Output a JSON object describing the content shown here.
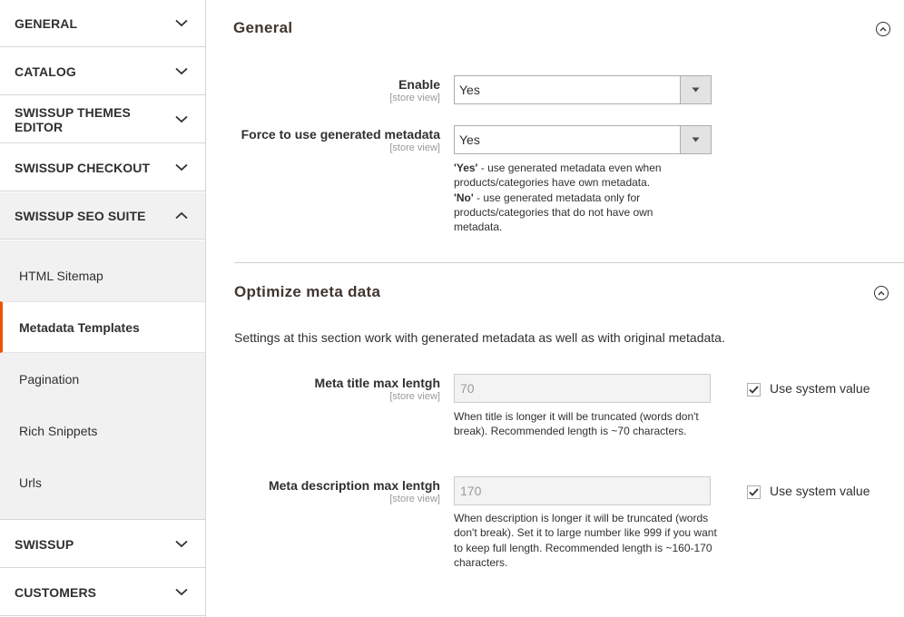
{
  "sidebar": {
    "sections": [
      {
        "label": "GENERAL",
        "expanded": false
      },
      {
        "label": "CATALOG",
        "expanded": false
      },
      {
        "label": "SWISSUP THEMES EDITOR",
        "expanded": false
      },
      {
        "label": "SWISSUP CHECKOUT",
        "expanded": false
      },
      {
        "label": "SWISSUP SEO SUITE",
        "expanded": true
      },
      {
        "label": "SWISSUP",
        "expanded": false
      },
      {
        "label": "CUSTOMERS",
        "expanded": false
      }
    ],
    "sub_items": [
      {
        "label": "HTML Sitemap",
        "active": false
      },
      {
        "label": "Metadata Templates",
        "active": true
      },
      {
        "label": "Pagination",
        "active": false
      },
      {
        "label": "Rich Snippets",
        "active": false
      },
      {
        "label": "Urls",
        "active": false
      }
    ],
    "accent_color": "#eb5202"
  },
  "general": {
    "title": "General",
    "enable": {
      "label": "Enable",
      "scope": "[store view]",
      "value": "Yes"
    },
    "force": {
      "label": "Force to use generated metadata",
      "scope": "[store view]",
      "value": "Yes",
      "note_yes_key": "'Yes'",
      "note_yes_text": " - use generated metadata even when products/categories have own metadata.",
      "note_no_key": "'No'",
      "note_no_text": " - use generated metadata only for products/categories that do not have own metadata."
    }
  },
  "optimize": {
    "title": "Optimize meta data",
    "intro": "Settings at this section work with generated metadata as well as with original metadata.",
    "title_len": {
      "label": "Meta title max lentgh",
      "scope": "[store view]",
      "value": "70",
      "use_system": "Use system value",
      "checked": true,
      "note": "When title is longer it will be truncated (words don't break). Recommended length is ~70 characters."
    },
    "desc_len": {
      "label": "Meta description max lentgh",
      "scope": "[store view]",
      "value": "170",
      "use_system": "Use system value",
      "checked": true,
      "note": "When description is longer it will be truncated (words don't break). Set it to large number like 999 if you want to keep full length. Recommended length is ~160-170 characters."
    }
  }
}
